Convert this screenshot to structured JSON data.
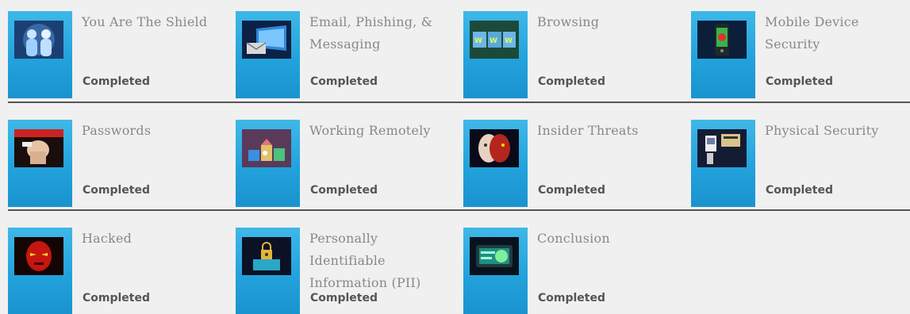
{
  "modules": [
    {
      "title": "You Are The Shield",
      "status": "Completed",
      "icon": "shield-people-icon"
    },
    {
      "title": "Email, Phishing, & Messaging",
      "status": "Completed",
      "icon": "email-monitor-icon"
    },
    {
      "title": "Browsing",
      "status": "Completed",
      "icon": "www-browsing-icon"
    },
    {
      "title": "Mobile Device Security",
      "status": "Completed",
      "icon": "mobile-phone-icon"
    },
    {
      "title": "Passwords",
      "status": "Completed",
      "icon": "password-hand-icon"
    },
    {
      "title": "Working Remotely",
      "status": "Completed",
      "icon": "remote-work-icon"
    },
    {
      "title": "Insider Threats",
      "status": "Completed",
      "icon": "insider-face-icon"
    },
    {
      "title": "Physical Security",
      "status": "Completed",
      "icon": "physical-badge-icon"
    },
    {
      "title": "Hacked",
      "status": "Completed",
      "icon": "hacker-mask-icon"
    },
    {
      "title": "Personally Identifiable Information (PII)",
      "status": "Completed",
      "icon": "pii-lock-icon"
    },
    {
      "title": "Conclusion",
      "status": "Completed",
      "icon": "conclusion-shield-icon"
    }
  ]
}
